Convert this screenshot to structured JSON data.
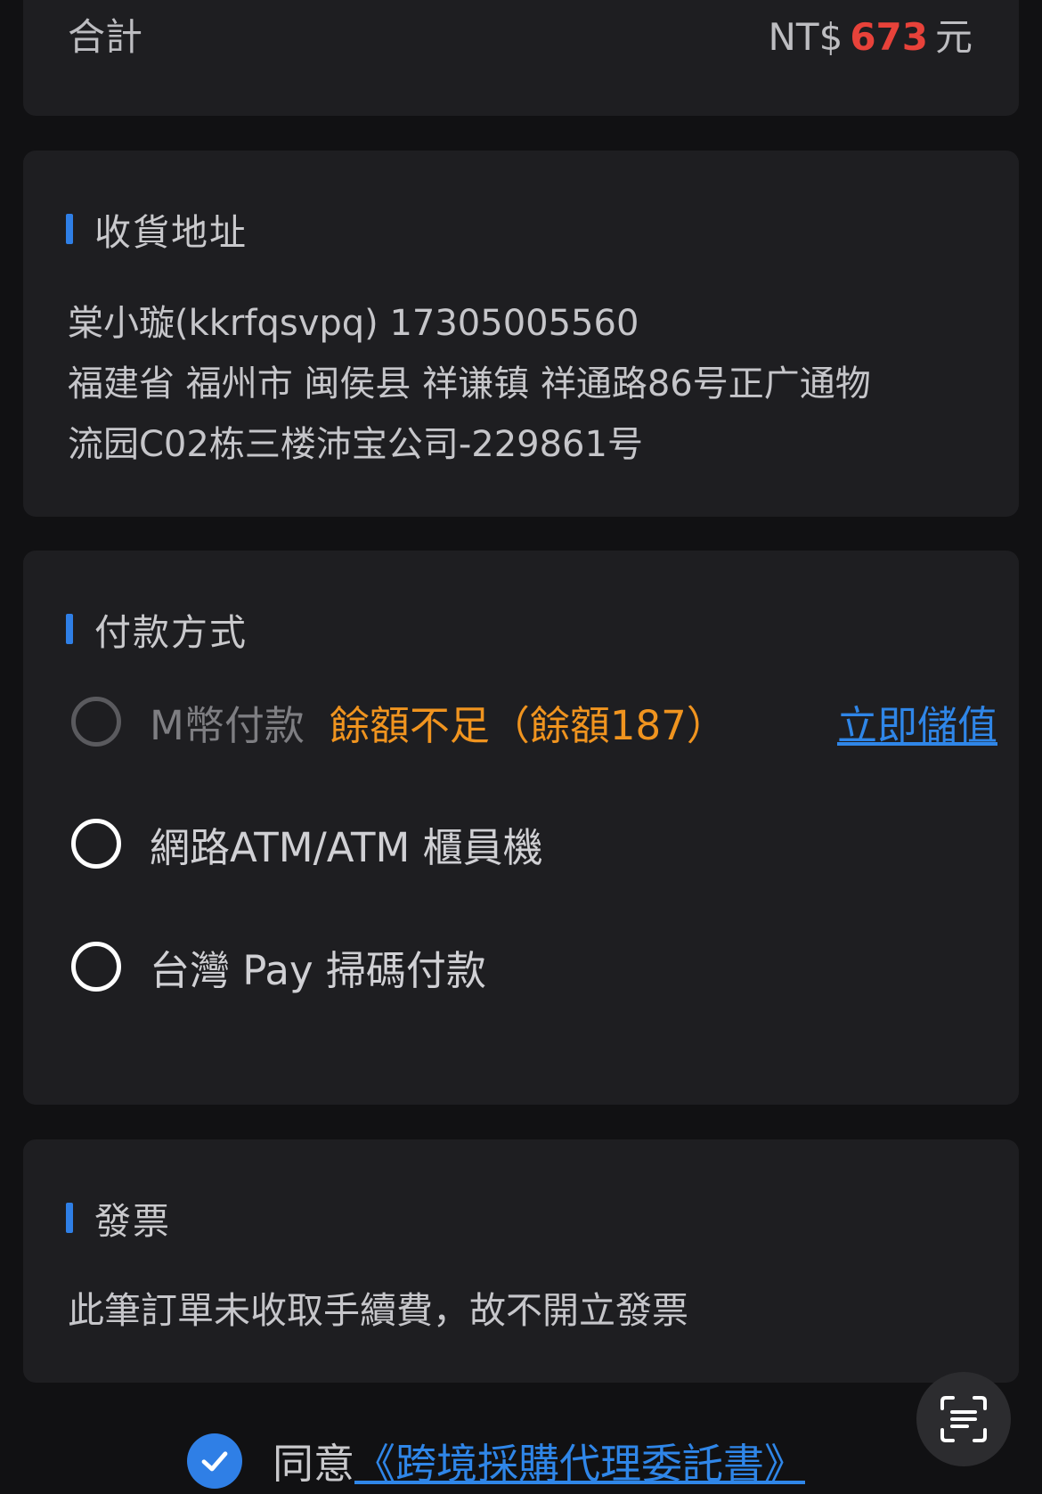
{
  "summary": {
    "total_label": "合計",
    "currency_prefix": "NT$",
    "total_amount": "673",
    "currency_suffix": "元"
  },
  "address": {
    "title": "收貨地址",
    "recipient_line": "棠小璇(kkrfqsvpq) 17305005560",
    "address_line1": "福建省 福州市 闽侯县 祥谦镇 祥通路86号正广通物",
    "address_line2": "流园C02栋三楼沛宝公司-229861号"
  },
  "payment": {
    "title": "付款方式",
    "options": [
      {
        "label": "M幣付款",
        "disabled": true,
        "note": "餘額不足（餘額187）",
        "action": "立即儲值"
      },
      {
        "label": "網路ATM/ATM 櫃員機",
        "disabled": false
      },
      {
        "label": "台灣 Pay 掃碼付款",
        "disabled": false
      }
    ]
  },
  "invoice": {
    "title": "發票",
    "text": "此筆訂單未收取手續費，故不開立發票"
  },
  "agreement": {
    "checked": true,
    "prefix": "同意",
    "link_text": "《跨境採購代理委託書》"
  },
  "colors": {
    "accent": "#2f7fe6",
    "price": "#e8423a",
    "warning": "#f0941f",
    "link": "#2f86e8",
    "card_bg": "#1e1e21",
    "page_bg": "#111113"
  },
  "icons": {
    "checkbox": "check-circle-icon",
    "floating_button": "scan-text-icon"
  }
}
